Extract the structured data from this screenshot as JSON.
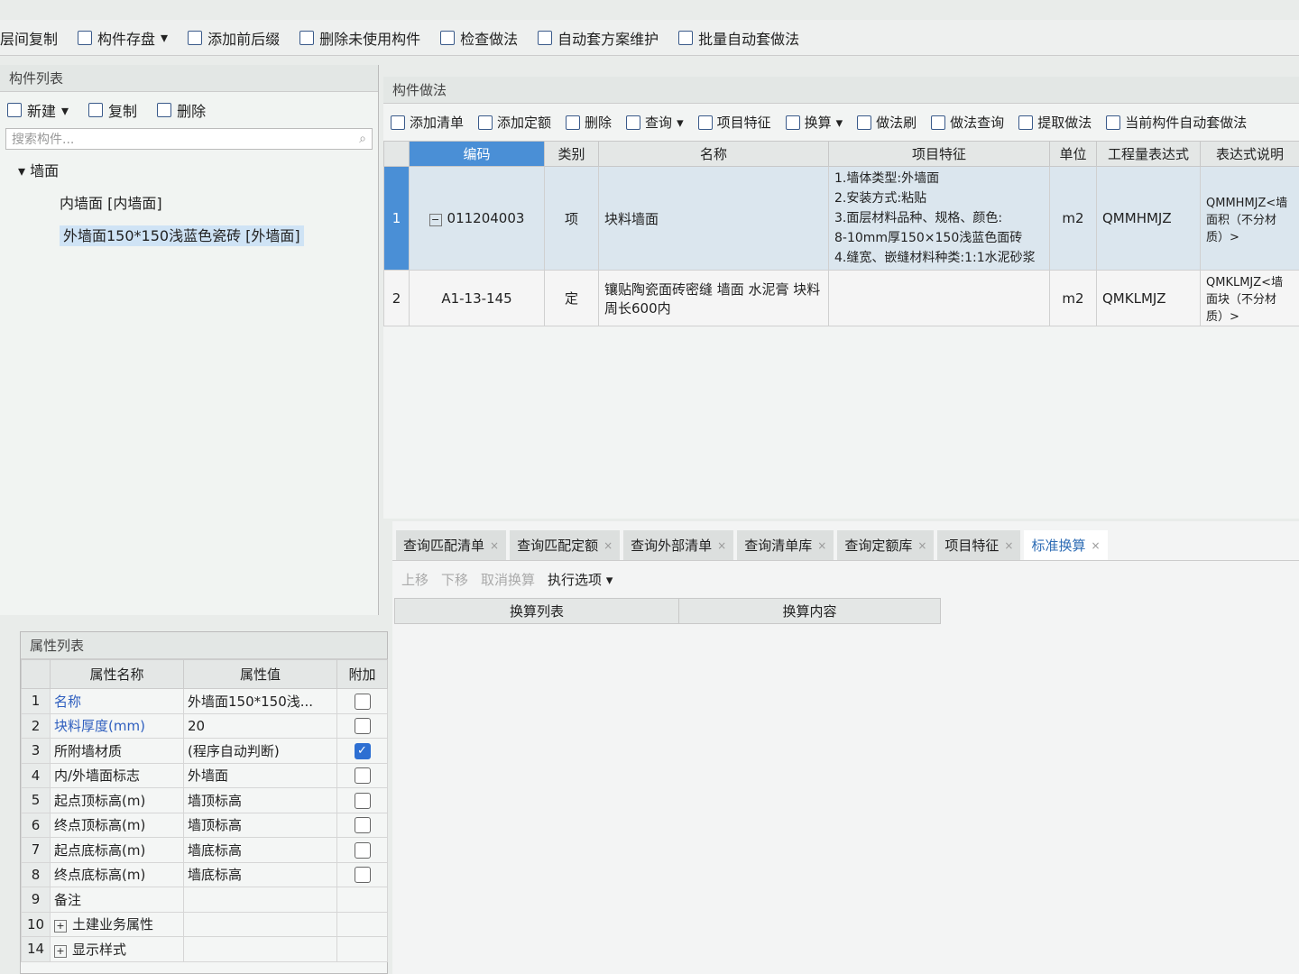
{
  "toolbar": {
    "items": [
      "层间复制",
      "构件存盘",
      "添加前后缀",
      "删除未使用构件",
      "检查做法",
      "自动套方案维护",
      "批量自动套做法"
    ]
  },
  "component_list": {
    "title": "构件列表",
    "new": "新建",
    "copy": "复制",
    "delete": "删除",
    "search_placeholder": "搜索构件...",
    "tree": {
      "root": "墙面",
      "children": [
        "内墙面 [内墙面]",
        "外墙面150*150浅蓝色瓷砖 [外墙面]"
      ]
    }
  },
  "method": {
    "title": "构件做法",
    "toolbar": [
      "添加清单",
      "添加定额",
      "删除",
      "查询",
      "项目特征",
      "换算",
      "做法刷",
      "做法查询",
      "提取做法",
      "当前构件自动套做法"
    ],
    "columns": [
      "",
      "编码",
      "类别",
      "名称",
      "项目特征",
      "单位",
      "工程量表达式",
      "表达式说明"
    ],
    "rows": [
      {
        "no": "1",
        "code": "011204003",
        "type": "项",
        "name": "块料墙面",
        "features": [
          "1.墙体类型:外墙面",
          "2.安装方式:粘贴",
          "3.面层材料品种、规格、颜色:",
          "8-10mm厚150×150浅蓝色面砖",
          "4.缝宽、嵌缝材料种类:1:1水泥砂浆"
        ],
        "unit": "m2",
        "expr": "QMMHMJZ",
        "desc": "QMMHMJZ<墙面积（不分材质）>"
      },
      {
        "no": "2",
        "code": "A1-13-145",
        "type": "定",
        "name": "镶贴陶瓷面砖密缝 墙面 水泥膏 块料周长600内",
        "features": [],
        "unit": "m2",
        "expr": "QMKLMJZ",
        "desc": "QMKLMJZ<墙面块（不分材质）>"
      }
    ]
  },
  "bottom": {
    "tabs": [
      "查询匹配清单",
      "查询匹配定额",
      "查询外部清单",
      "查询清单库",
      "查询定额库",
      "项目特征",
      "标准换算"
    ],
    "active_tab": "标准换算",
    "actions": [
      "上移",
      "下移",
      "取消换算",
      "执行选项"
    ],
    "columns": [
      "换算列表",
      "换算内容"
    ]
  },
  "props": {
    "title": "属性列表",
    "columns": [
      "属性名称",
      "属性值",
      "附加"
    ],
    "rows": [
      {
        "idx": "1",
        "name": "名称",
        "value": "外墙面150*150浅...",
        "blue": true,
        "checked": false
      },
      {
        "idx": "2",
        "name": "块料厚度(mm)",
        "value": "20",
        "blue": true,
        "checked": false
      },
      {
        "idx": "3",
        "name": "所附墙材质",
        "value": "(程序自动判断)",
        "checked": true
      },
      {
        "idx": "4",
        "name": "内/外墙面标志",
        "value": "外墙面",
        "checked": false
      },
      {
        "idx": "5",
        "name": "起点顶标高(m)",
        "value": "墙顶标高",
        "checked": false
      },
      {
        "idx": "6",
        "name": "终点顶标高(m)",
        "value": "墙顶标高",
        "checked": false
      },
      {
        "idx": "7",
        "name": "起点底标高(m)",
        "value": "墙底标高",
        "checked": false
      },
      {
        "idx": "8",
        "name": "终点底标高(m)",
        "value": "墙底标高",
        "checked": false
      },
      {
        "idx": "9",
        "name": "备注",
        "value": ""
      },
      {
        "idx": "10",
        "name": "土建业务属性",
        "value": "",
        "expand": true
      },
      {
        "idx": "14",
        "name": "显示样式",
        "value": "",
        "expand": true
      }
    ]
  }
}
